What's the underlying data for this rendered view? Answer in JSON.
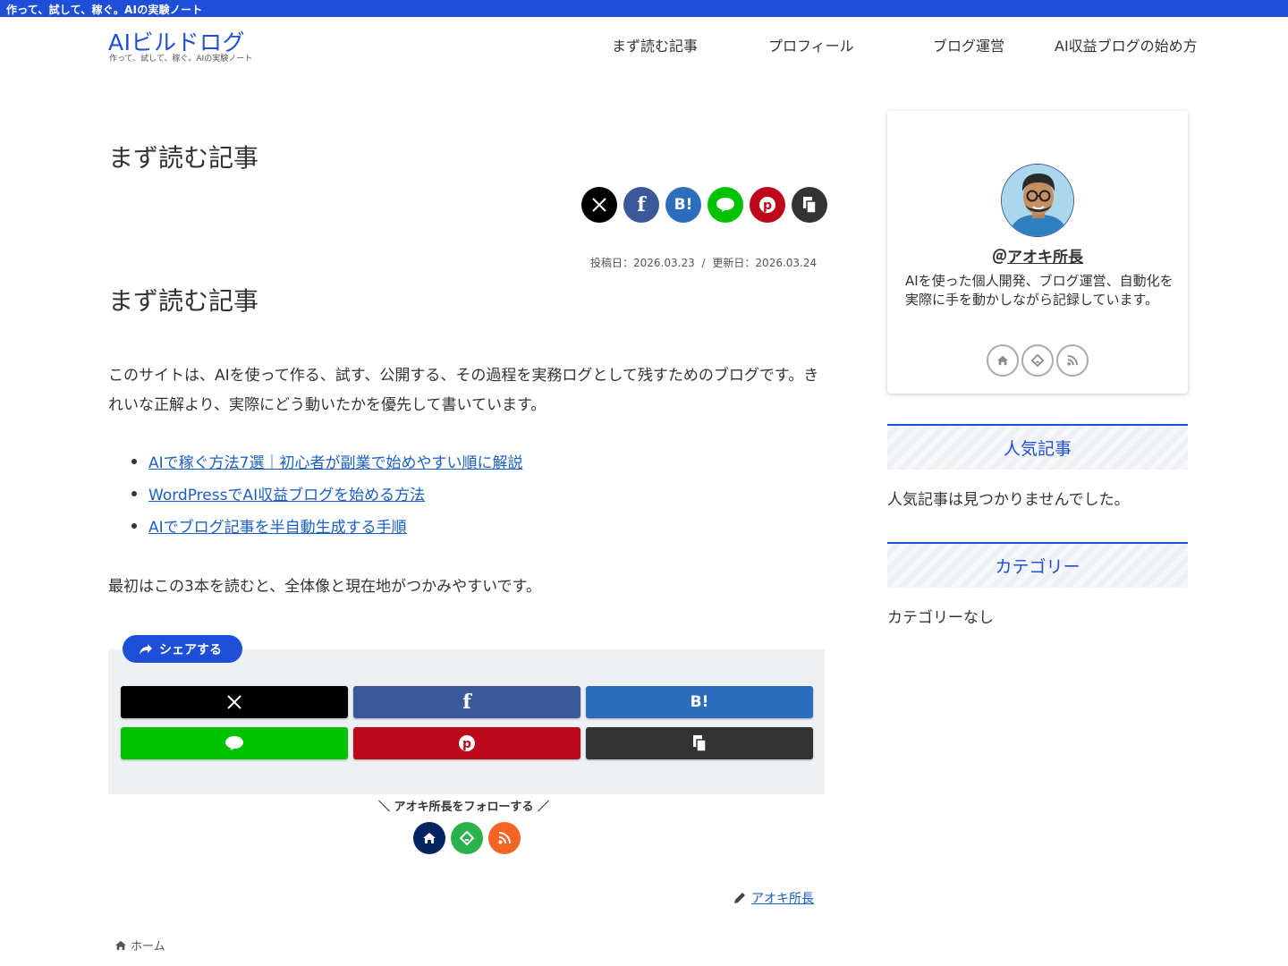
{
  "topbar": {
    "tagline": "作って、試して、稼ぐ。AIの実験ノート"
  },
  "header": {
    "logo": "AIビルドログ",
    "logo_sub": "作って、試して、稼ぐ。AIの実験ノート",
    "nav": [
      "まず読む記事",
      "プロフィール",
      "ブログ運営",
      "AI収益ブログの始め方"
    ]
  },
  "article": {
    "title": "まず読む記事",
    "posted": "投稿日：2026.03.23",
    "separator": "/",
    "updated": "更新日：2026.03.24",
    "heading": "まず読む記事",
    "intro": "このサイトは、AIを使って作る、試す、公開する、その過程を実務ログとして残すためのブログです。きれいな正解より、実際にどう動いたかを優先して書いています。",
    "links": [
      "AIで稼ぐ方法7選｜初心者が副業で始めやすい順に解説",
      "WordPressでAI収益ブログを始める方法",
      "AIでブログ記事を半自動生成する手順"
    ],
    "outro": "最初はこの3本を読むと、全体像と現在地がつかみやすいです。",
    "share_label": "シェアする",
    "follow_label": "＼ アオキ所長をフォローする ／",
    "author": "アオキ所長"
  },
  "breadcrumb": {
    "home": "ホーム"
  },
  "sidebar": {
    "profile": {
      "name": "アオキ所長",
      "desc": "AIを使った個人開発、ブログ運営、自動化を実際に手を動かしながら記録しています。"
    },
    "widgets": [
      {
        "title": "人気記事",
        "body": "人気記事は見つかりませんでした。"
      },
      {
        "title": "カテゴリー",
        "body": "カテゴリーなし"
      }
    ]
  },
  "colors": {
    "accent": "#1f4ed8",
    "x": "#000000",
    "facebook": "#3b5998",
    "hatena": "#2c6ebd",
    "line": "#00c300",
    "pinterest": "#bd081c",
    "copy": "#333333",
    "follow_home": "#002561",
    "follow_feedly": "#2bb24c",
    "follow_rss": "#f26522"
  },
  "icons": {
    "top_share": [
      "x-icon",
      "facebook-icon",
      "hatena-bookmark-icon",
      "line-icon",
      "pinterest-icon",
      "copy-icon"
    ],
    "follow": [
      "home-icon",
      "feedly-icon",
      "rss-icon"
    ]
  }
}
